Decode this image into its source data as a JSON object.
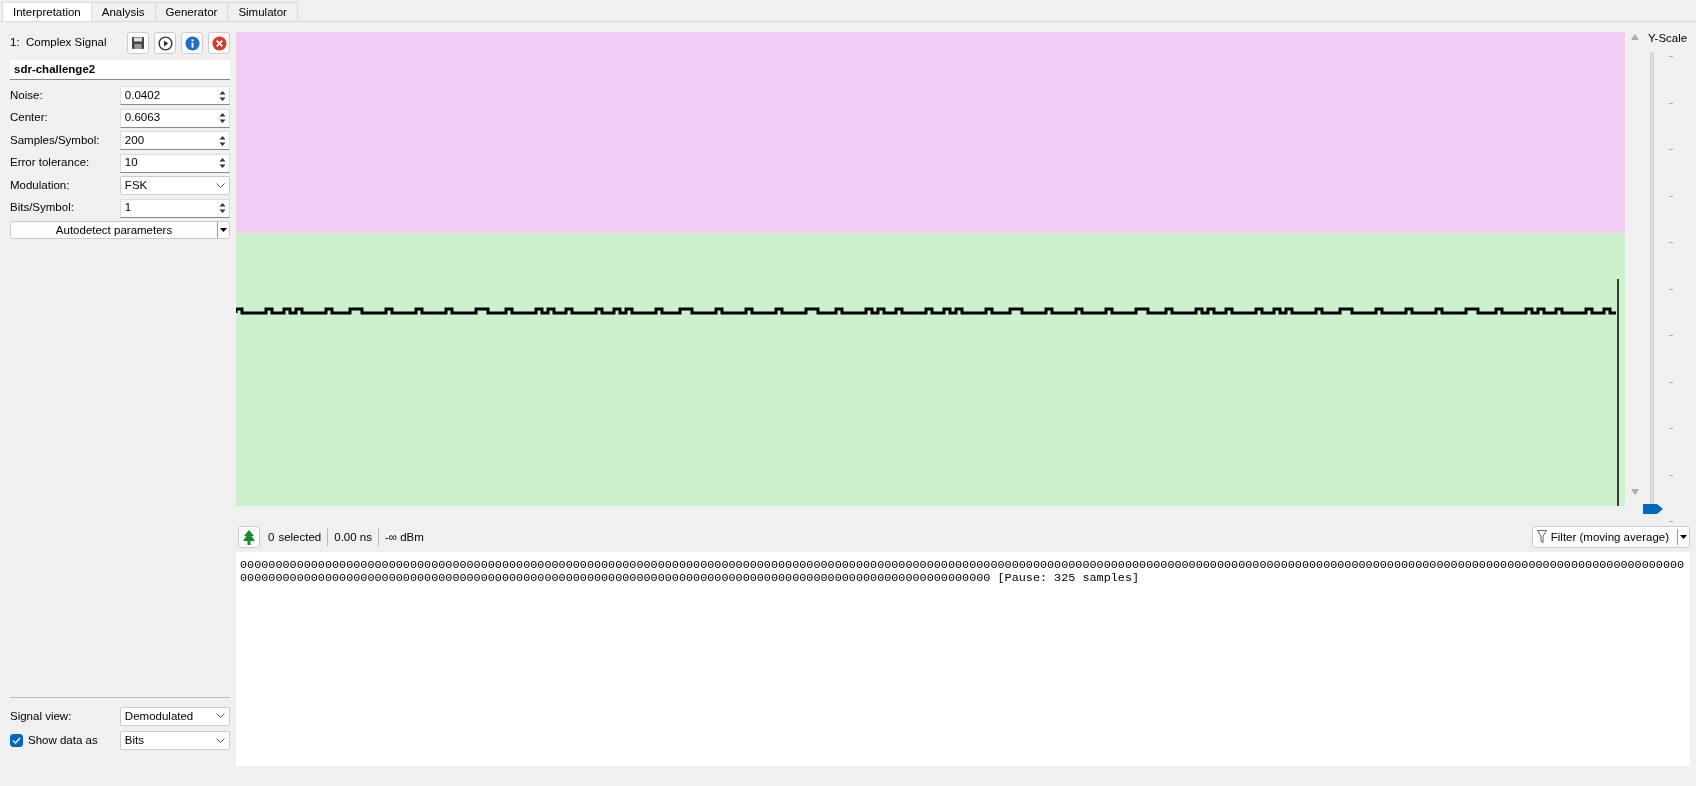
{
  "tabs": [
    {
      "label": "Interpretation",
      "selected": true
    },
    {
      "label": "Analysis",
      "selected": false
    },
    {
      "label": "Generator",
      "selected": false
    },
    {
      "label": "Simulator",
      "selected": false
    }
  ],
  "signal": {
    "title": "1:  Complex Signal",
    "name": "sdr-challenge2"
  },
  "parameters": [
    {
      "label": "Noise:",
      "kind": "spin",
      "value": "0.0402"
    },
    {
      "label": "Center:",
      "kind": "spin",
      "value": "0.6063"
    },
    {
      "label": "Samples/Symbol:",
      "kind": "spin",
      "value": "200"
    },
    {
      "label": "Error tolerance:",
      "kind": "spin",
      "value": "10"
    },
    {
      "label": "Modulation:",
      "kind": "combo",
      "value": "FSK"
    },
    {
      "label": "Bits/Symbol:",
      "kind": "spin",
      "value": "1"
    }
  ],
  "autodetect": {
    "label": "Autodetect parameters"
  },
  "signal_view": {
    "label": "Signal view:",
    "value": "Demodulated"
  },
  "show_data": {
    "label": "Show data as",
    "checked": true,
    "value": "Bits"
  },
  "y_scale": {
    "label": "Y-Scale",
    "level": 0
  },
  "status": {
    "selected_count": "0",
    "selected_label": "selected",
    "duration": "0.00 ns",
    "power": "-∞ dBm"
  },
  "filter": {
    "label": "Filter (moving average)"
  },
  "data_lines": [
    "000000000000000000000000000000000000000000000000000000000000000000000000000000000000000000000000000000000000000000000000000000000000000000000000000000000000000000000000000000000000000000000000000000000000",
    "0000000000000000000000000000000000000000000000000000000000000000000000000000000000000000000000000000000000 [Pause: 325 samples]"
  ]
}
